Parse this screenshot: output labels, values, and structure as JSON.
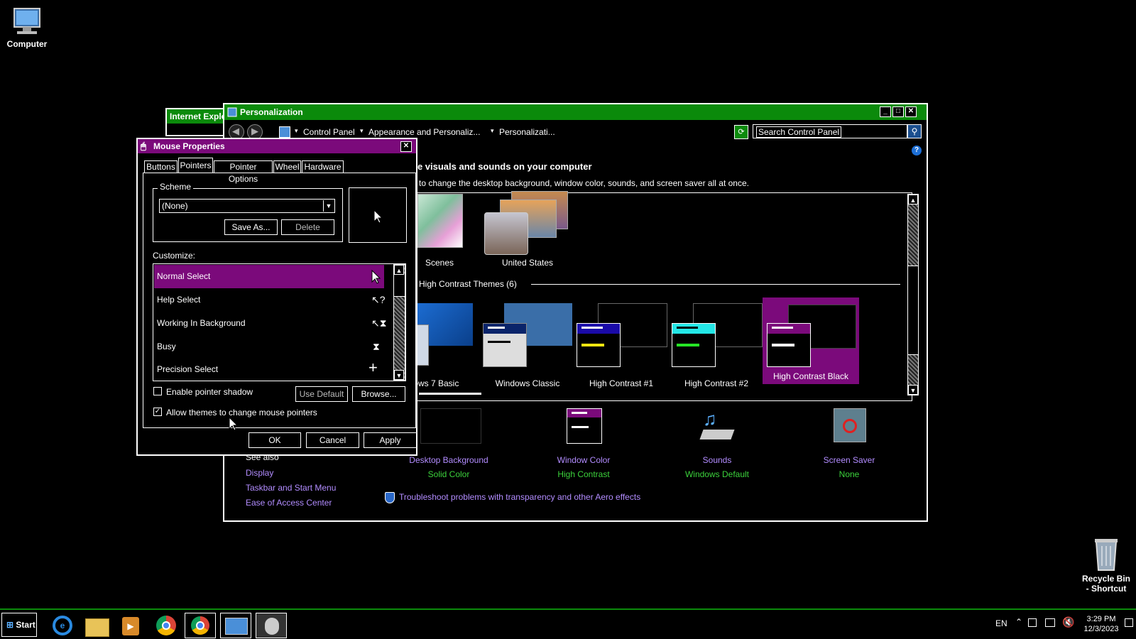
{
  "desktop": {
    "computer_label": "Computer",
    "recycle_label_1": "Recycle Bin",
    "recycle_label_2": "- Shortcut"
  },
  "ie_window": {
    "title": "Internet Explo"
  },
  "personalization": {
    "title": "Personalization",
    "breadcrumb": [
      "Control Panel",
      "Appearance and Personaliz...",
      "Personalizati..."
    ],
    "search_placeholder": "Search Control Panel",
    "heading": "he visuals and sounds on your computer",
    "subheading": "e to change the desktop background, window color, sounds, and screen saver all at once.",
    "section_label": "d High Contrast Themes (6)",
    "top_themes": [
      {
        "name": "Scenes"
      },
      {
        "name": "United States"
      }
    ],
    "hc_themes": [
      {
        "name": "dows 7 Basic"
      },
      {
        "name": "Windows Classic"
      },
      {
        "name": "High Contrast #1"
      },
      {
        "name": "High Contrast #2"
      },
      {
        "name": "High Contrast Black"
      }
    ],
    "bottom_items": [
      {
        "label": "Desktop Background",
        "value": "Solid Color"
      },
      {
        "label": "Window Color",
        "value": "High Contrast"
      },
      {
        "label": "Sounds",
        "value": "Windows Default"
      },
      {
        "label": "Screen Saver",
        "value": "None"
      }
    ],
    "see_also": {
      "title": "See also",
      "links": [
        "Display",
        "Taskbar and Start Menu",
        "Ease of Access Center"
      ]
    },
    "troubleshoot_link": "Troubleshoot problems with transparency and other Aero effects",
    "colors": {
      "title_green": "#0b8a0b",
      "selected_purple": "#7b0a7b",
      "link": "#b28cff",
      "value_green": "#3cd23c"
    }
  },
  "mouse_props": {
    "title": "Mouse Properties",
    "tabs": [
      "Buttons",
      "Pointers",
      "Pointer Options",
      "Wheel",
      "Hardware"
    ],
    "active_tab": "Pointers",
    "scheme_label": "Scheme",
    "scheme_value": "(None)",
    "save_as": "Save As...",
    "delete": "Delete",
    "customize_label": "Customize:",
    "pointers": [
      {
        "name": "Normal Select",
        "icon": "arrow-cursor-icon"
      },
      {
        "name": "Help Select",
        "icon": "help-cursor-icon"
      },
      {
        "name": "Working In Background",
        "icon": "working-cursor-icon"
      },
      {
        "name": "Busy",
        "icon": "hourglass-icon"
      },
      {
        "name": "Precision Select",
        "icon": "crosshair-icon"
      }
    ],
    "enable_shadow": "Enable pointer shadow",
    "enable_shadow_checked": false,
    "use_default": "Use Default",
    "browse": "Browse...",
    "allow_themes": "Allow themes to change mouse pointers",
    "allow_themes_checked": true,
    "ok": "OK",
    "cancel": "Cancel",
    "apply": "Apply"
  },
  "taskbar": {
    "start": "Start",
    "apps": [
      "internet-explorer-icon",
      "file-explorer-icon",
      "media-player-icon",
      "chrome-icon",
      "chrome-profile-icon",
      "control-panel-icon",
      "mouse-icon"
    ],
    "lang": "EN",
    "time": "3:29 PM",
    "date": "12/3/2023"
  }
}
